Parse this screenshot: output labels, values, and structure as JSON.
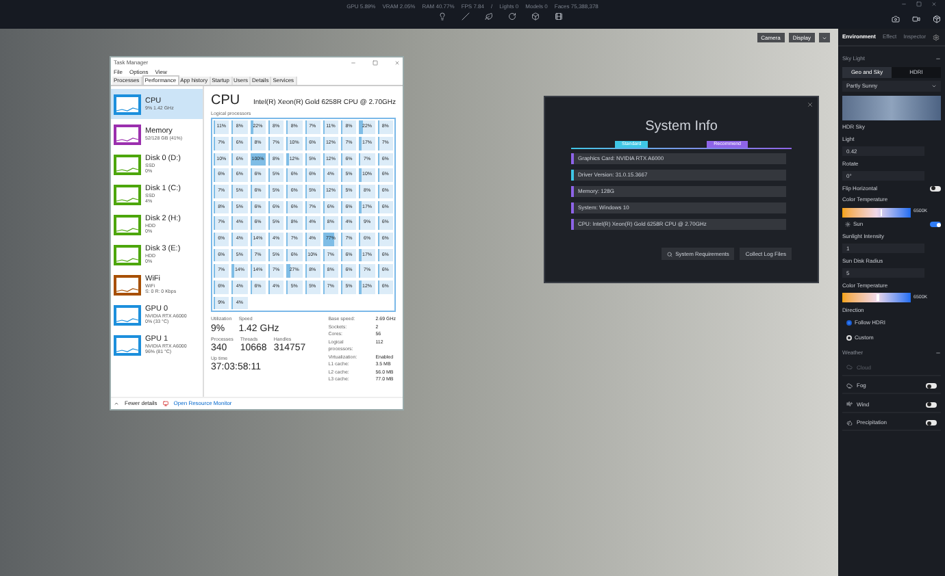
{
  "top_bar": {
    "stats": [
      "GPU 5.89%",
      "VRAM 2.05%",
      "RAM 40.77%",
      "FPS 7.84",
      "/",
      "Lights 0",
      "Models 0",
      "Faces 75,388,378"
    ]
  },
  "viewport_buttons": [
    "Camera",
    "Display"
  ],
  "task_manager": {
    "title": "Task Manager",
    "menu": [
      "File",
      "Options",
      "View"
    ],
    "tabs": [
      {
        "label": "Processes",
        "selected": false
      },
      {
        "label": "Performance",
        "selected": true
      },
      {
        "label": "App history",
        "selected": false
      },
      {
        "label": "Startup",
        "selected": false
      },
      {
        "label": "Users",
        "selected": false
      },
      {
        "label": "Details",
        "selected": false
      },
      {
        "label": "Services",
        "selected": false
      }
    ],
    "sidebar": [
      {
        "name": "CPU",
        "line_1": "9% 1.42 GHz",
        "color": "#1c8fdc",
        "selected": true
      },
      {
        "name": "Memory",
        "line_1": "52/128 GB (41%)",
        "color": "#9b2fae",
        "selected": false
      },
      {
        "name": "Disk 0 (D:)",
        "line_1": "SSD",
        "line_2": "0%",
        "color": "#4da60c",
        "selected": false
      },
      {
        "name": "Disk 1 (C:)",
        "line_1": "SSD",
        "line_2": "4%",
        "color": "#4da60c",
        "selected": false
      },
      {
        "name": "Disk 2 (H:)",
        "line_1": "HDD",
        "line_2": "0%",
        "color": "#4da60c",
        "selected": false
      },
      {
        "name": "Disk 3 (E:)",
        "line_1": "HDD",
        "line_2": "0%",
        "color": "#4da60c",
        "selected": false
      },
      {
        "name": "WiFi",
        "line_1": "WiFi",
        "line_2": "S: 0 R: 0 Kbps",
        "color": "#a74f01",
        "selected": false
      },
      {
        "name": "GPU 0",
        "line_1": "NVIDIA RTX A6000",
        "line_2": "0% (33 °C)",
        "color": "#1c8fdc",
        "selected": false
      },
      {
        "name": "GPU 1",
        "line_1": "NVIDIA RTX A6000",
        "line_2": "96% (81 °C)",
        "color": "#1c8fdc",
        "selected": false
      }
    ],
    "heading": "CPU",
    "model": "Intel(R) Xeon(R) Gold 6258R CPU @ 2.70GHz",
    "grid_label": "Logical processors",
    "cells": [
      [
        {
          "text": "11%",
          "level": 0.11
        },
        {
          "text": "8%",
          "level": 0.08
        },
        {
          "text": "22%",
          "level": 0.22
        },
        {
          "text": "8%",
          "level": 0.08
        },
        {
          "text": "8%",
          "level": 0.08
        },
        {
          "text": "7%",
          "level": 0.07
        },
        {
          "text": "11%",
          "level": 0.11
        },
        {
          "text": "8%",
          "level": 0.08
        },
        {
          "text": "22%",
          "level": 0.22
        },
        {
          "text": "8%",
          "level": 0.08
        }
      ],
      [
        {
          "text": "7%",
          "level": 0.07
        },
        {
          "text": "6%",
          "level": 0.06
        },
        {
          "text": "8%",
          "level": 0.08
        },
        {
          "text": "7%",
          "level": 0.07
        },
        {
          "text": "10%",
          "level": 0.1
        },
        {
          "text": "6%",
          "level": 0.06
        },
        {
          "text": "12%",
          "level": 0.12
        },
        {
          "text": "7%",
          "level": 0.07
        },
        {
          "text": "17%",
          "level": 0.17
        },
        {
          "text": "7%",
          "level": 0.07
        }
      ],
      [
        {
          "text": "10%",
          "level": 0.1
        },
        {
          "text": "6%",
          "level": 0.06
        },
        {
          "text": "100%",
          "level": 1
        },
        {
          "text": "8%",
          "level": 0.08
        },
        {
          "text": "12%",
          "level": 0.12
        },
        {
          "text": "5%",
          "level": 0.05
        },
        {
          "text": "12%",
          "level": 0.12
        },
        {
          "text": "6%",
          "level": 0.06
        },
        {
          "text": "7%",
          "level": 0.07
        },
        {
          "text": "6%",
          "level": 0.06
        }
      ],
      [
        {
          "text": "6%",
          "level": 0.06
        },
        {
          "text": "6%",
          "level": 0.06
        },
        {
          "text": "6%",
          "level": 0.06
        },
        {
          "text": "5%",
          "level": 0.05
        },
        {
          "text": "6%",
          "level": 0.06
        },
        {
          "text": "6%",
          "level": 0.06
        },
        {
          "text": "4%",
          "level": 0.04
        },
        {
          "text": "5%",
          "level": 0.05
        },
        {
          "text": "10%",
          "level": 0.1
        },
        {
          "text": "6%",
          "level": 0.06
        }
      ],
      [
        {
          "text": "7%",
          "level": 0.07
        },
        {
          "text": "5%",
          "level": 0.05
        },
        {
          "text": "6%",
          "level": 0.06
        },
        {
          "text": "5%",
          "level": 0.05
        },
        {
          "text": "6%",
          "level": 0.06
        },
        {
          "text": "5%",
          "level": 0.05
        },
        {
          "text": "12%",
          "level": 0.12
        },
        {
          "text": "5%",
          "level": 0.05
        },
        {
          "text": "8%",
          "level": 0.08
        },
        {
          "text": "6%",
          "level": 0.06
        }
      ],
      [
        {
          "text": "8%",
          "level": 0.08
        },
        {
          "text": "5%",
          "level": 0.05
        },
        {
          "text": "6%",
          "level": 0.06
        },
        {
          "text": "6%",
          "level": 0.06
        },
        {
          "text": "6%",
          "level": 0.06
        },
        {
          "text": "7%",
          "level": 0.07
        },
        {
          "text": "6%",
          "level": 0.06
        },
        {
          "text": "6%",
          "level": 0.06
        },
        {
          "text": "17%",
          "level": 0.17
        },
        {
          "text": "6%",
          "level": 0.06
        }
      ],
      [
        {
          "text": "7%",
          "level": 0.07
        },
        {
          "text": "4%",
          "level": 0.04
        },
        {
          "text": "6%",
          "level": 0.06
        },
        {
          "text": "5%",
          "level": 0.05
        },
        {
          "text": "8%",
          "level": 0.08
        },
        {
          "text": "4%",
          "level": 0.04
        },
        {
          "text": "8%",
          "level": 0.08
        },
        {
          "text": "4%",
          "level": 0.04
        },
        {
          "text": "9%",
          "level": 0.09
        },
        {
          "text": "6%",
          "level": 0.06
        }
      ],
      [
        {
          "text": "6%",
          "level": 0.06
        },
        {
          "text": "4%",
          "level": 0.04
        },
        {
          "text": "14%",
          "level": 0.14
        },
        {
          "text": "4%",
          "level": 0.04
        },
        {
          "text": "7%",
          "level": 0.07
        },
        {
          "text": "4%",
          "level": 0.04
        },
        {
          "text": "77%",
          "level": 0.77
        },
        {
          "text": "7%",
          "level": 0.07
        },
        {
          "text": "6%",
          "level": 0.06
        },
        {
          "text": "6%",
          "level": 0.06
        }
      ],
      [
        {
          "text": "6%",
          "level": 0.06
        },
        {
          "text": "5%",
          "level": 0.05
        },
        {
          "text": "7%",
          "level": 0.07
        },
        {
          "text": "5%",
          "level": 0.05
        },
        {
          "text": "6%",
          "level": 0.06
        },
        {
          "text": "10%",
          "level": 0.1
        },
        {
          "text": "7%",
          "level": 0.07
        },
        {
          "text": "6%",
          "level": 0.06
        },
        {
          "text": "17%",
          "level": 0.17
        },
        {
          "text": "6%",
          "level": 0.06
        }
      ],
      [
        {
          "text": "7%",
          "level": 0.07
        },
        {
          "text": "14%",
          "level": 0.14
        },
        {
          "text": "14%",
          "level": 0.14
        },
        {
          "text": "7%",
          "level": 0.07
        },
        {
          "text": "27%",
          "level": 0.27
        },
        {
          "text": "8%",
          "level": 0.08
        },
        {
          "text": "8%",
          "level": 0.08
        },
        {
          "text": "6%",
          "level": 0.06
        },
        {
          "text": "7%",
          "level": 0.07
        },
        {
          "text": "6%",
          "level": 0.06
        }
      ],
      [
        {
          "text": "6%",
          "level": 0.06
        },
        {
          "text": "4%",
          "level": 0.04
        },
        {
          "text": "6%",
          "level": 0.06
        },
        {
          "text": "4%",
          "level": 0.04
        },
        {
          "text": "5%",
          "level": 0.05
        },
        {
          "text": "5%",
          "level": 0.05
        },
        {
          "text": "7%",
          "level": 0.07
        },
        {
          "text": "5%",
          "level": 0.05
        },
        {
          "text": "12%",
          "level": 0.12
        },
        {
          "text": "6%",
          "level": 0.06
        }
      ],
      [
        {
          "text": "9%",
          "level": 0.09
        },
        {
          "text": "4%",
          "level": 0.04
        }
      ]
    ],
    "big_stats": [
      {
        "label": "Utilization",
        "value": "9%"
      },
      {
        "label": "Speed",
        "value": "1.42 GHz"
      },
      {
        "label": "Processes",
        "value": "340"
      },
      {
        "label": "Threads",
        "value": "10668"
      },
      {
        "label": "Handles",
        "value": "314757"
      },
      {
        "label": "Up time",
        "value": "37:03:58:11"
      }
    ],
    "specs": [
      {
        "label": "Base speed:",
        "value": "2.69 GHz"
      },
      {
        "label": "Sockets:",
        "value": "2"
      },
      {
        "label": "Cores:",
        "value": "56"
      },
      {
        "label": "Logical processors:",
        "value": "112"
      },
      {
        "label": "Virtualization:",
        "value": "Enabled"
      },
      {
        "label": "L1 cache:",
        "value": "3.5 MB"
      },
      {
        "label": "L2 cache:",
        "value": "56.0 MB"
      },
      {
        "label": "L3 cache:",
        "value": "77.0 MB"
      }
    ],
    "footer": {
      "fewer": "Fewer details",
      "monitor": "Open Resource Monitor"
    }
  },
  "system_info": {
    "title": "System Info",
    "tabs": [
      {
        "label": "Standard",
        "color": "#3ec6e6"
      },
      {
        "label": "Recommend",
        "color": "#8e64e8"
      }
    ],
    "rows": [
      {
        "text": "Graphics Card: NVIDIA RTX A6000",
        "color": "#8e64e8"
      },
      {
        "text": "Driver Version: 31.0.15.3667",
        "color": "#3ec6e6"
      },
      {
        "text": "Memory: 128G",
        "color": "#8e64e8"
      },
      {
        "text": "System: Windows 10",
        "color": "#8e64e8"
      },
      {
        "text": "CPU: Intel(R) Xeon(R) Gold 6258R CPU @ 2.70GHz",
        "color": "#8e64e8"
      }
    ],
    "buttons": [
      "System Requirements",
      "Collect Log Files"
    ]
  },
  "right_panel": {
    "tabs": [
      {
        "label": "Environment",
        "selected": true
      },
      {
        "label": "Effect",
        "selected": false
      },
      {
        "label": "Inspector",
        "selected": false
      }
    ],
    "controls": [
      {
        "kind": "section",
        "label": "Sky Light"
      },
      {
        "kind": "segmented",
        "options": [
          {
            "label": "Geo and Sky",
            "selected": true
          },
          {
            "label": "HDRI",
            "selected": false
          }
        ]
      },
      {
        "kind": "dropdown",
        "value": "Partly Sunny"
      },
      {
        "kind": "sky_image"
      },
      {
        "kind": "label",
        "label": "HDR Sky"
      },
      {
        "kind": "label",
        "label": "Light"
      },
      {
        "kind": "field",
        "value": "0.42"
      },
      {
        "kind": "label",
        "label": "Rotate"
      },
      {
        "kind": "field",
        "value": "0°"
      },
      {
        "kind": "switch",
        "label": "Flip Horizontal",
        "on": false
      },
      {
        "kind": "label",
        "label": "Color Temperature"
      },
      {
        "kind": "gradient",
        "reading": "6500K",
        "level": 0.55
      },
      {
        "kind": "sun_switch",
        "label": "Sun",
        "on": true
      },
      {
        "kind": "label",
        "label": "Sunlight Intensity"
      },
      {
        "kind": "field",
        "value": "1"
      },
      {
        "kind": "label",
        "label": "Sun Disk Radius"
      },
      {
        "kind": "field",
        "value": "5"
      },
      {
        "kind": "label",
        "label": "Color Temperature"
      },
      {
        "kind": "gradient",
        "reading": "6500K",
        "level": 0.5
      },
      {
        "kind": "label",
        "label": "Direction"
      },
      {
        "kind": "radio",
        "label": "Follow HDRI",
        "selected": true
      },
      {
        "kind": "radio",
        "label": "Custom",
        "selected": false
      },
      {
        "kind": "section",
        "label": "Weather"
      },
      {
        "kind": "weather",
        "label": "Cloud",
        "disabled": true,
        "on": false
      },
      {
        "kind": "weather",
        "label": "Fog",
        "disabled": false,
        "on": false
      },
      {
        "kind": "weather",
        "label": "Wind",
        "disabled": false,
        "on": false
      },
      {
        "kind": "weather",
        "label": "Precipitation",
        "disabled": false,
        "on": false
      }
    ]
  }
}
